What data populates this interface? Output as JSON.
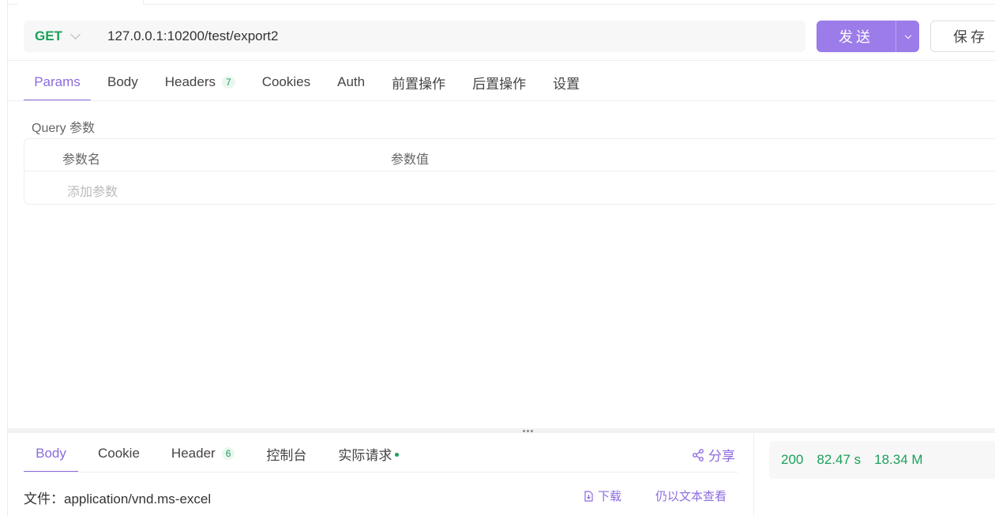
{
  "request": {
    "method": "GET",
    "url": "127.0.0.1:10200/test/export2",
    "send_label": "发送",
    "save_label": "保存"
  },
  "request_tabs": [
    {
      "label": "Params",
      "active": true
    },
    {
      "label": "Body"
    },
    {
      "label": "Headers",
      "badge": "7"
    },
    {
      "label": "Cookies"
    },
    {
      "label": "Auth"
    },
    {
      "label": "前置操作"
    },
    {
      "label": "后置操作"
    },
    {
      "label": "设置"
    }
  ],
  "params": {
    "section_title": "Query 参数",
    "col_name": "参数名",
    "col_value": "参数值",
    "add_placeholder": "添加参数"
  },
  "response_tabs": [
    {
      "label": "Body",
      "active": true
    },
    {
      "label": "Cookie"
    },
    {
      "label": "Header",
      "badge": "6"
    },
    {
      "label": "控制台"
    },
    {
      "label": "实际请求"
    }
  ],
  "response": {
    "share_label": "分享",
    "file_label": "文件：application/vnd.ms-excel",
    "download_label": "下载",
    "view_text_label": "仍以文本查看",
    "status_code": "200",
    "time": "82.47 s",
    "size": "18.34 M"
  },
  "colors": {
    "accent": "#8c6be0",
    "button": "#9b7ce9",
    "success": "#19a05a"
  },
  "icons": [
    "chevron-down-icon",
    "share-icon",
    "download-icon"
  ]
}
